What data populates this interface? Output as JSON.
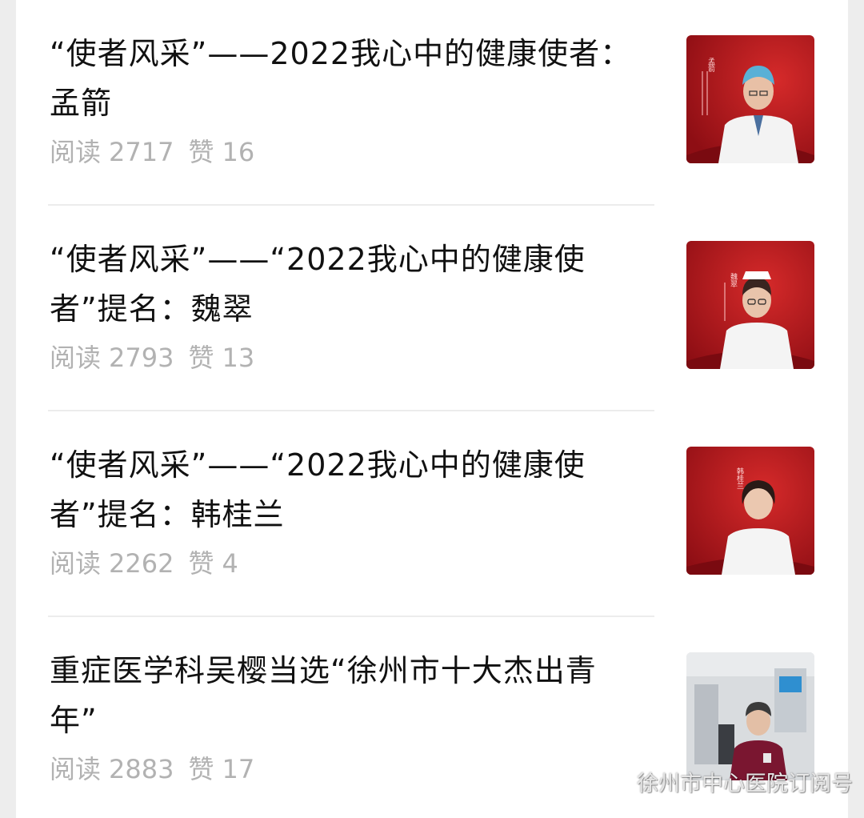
{
  "articles": [
    {
      "title": "“使者风采”——2022我心中的健康使者：孟箭",
      "read_label": "阅读",
      "read_count": "2717",
      "like_label": "赞",
      "like_count": "16",
      "thumbnail_name": "孟箭"
    },
    {
      "title": "“使者风采”——“2022我心中的健康使者”提名：魏翠",
      "read_label": "阅读",
      "read_count": "2793",
      "like_label": "赞",
      "like_count": "13",
      "thumbnail_name": "魏翠"
    },
    {
      "title": "“使者风采”——“2022我心中的健康使者”提名：韩桂兰",
      "read_label": "阅读",
      "read_count": "2262",
      "like_label": "赞",
      "like_count": "4",
      "thumbnail_name": "韩桂兰"
    },
    {
      "title": "重症医学科吴樱当选“徐州市十大杰出青年”",
      "read_label": "阅读",
      "read_count": "2883",
      "like_label": "赞",
      "like_count": "17"
    }
  ],
  "watermark": {
    "text": "徐州市中心医院订阅号",
    "icon": "wechat-icon"
  },
  "colors": {
    "thumbnail_red": "#b4141c",
    "meta_gray": "#b2b2b2",
    "title_black": "#111111"
  }
}
